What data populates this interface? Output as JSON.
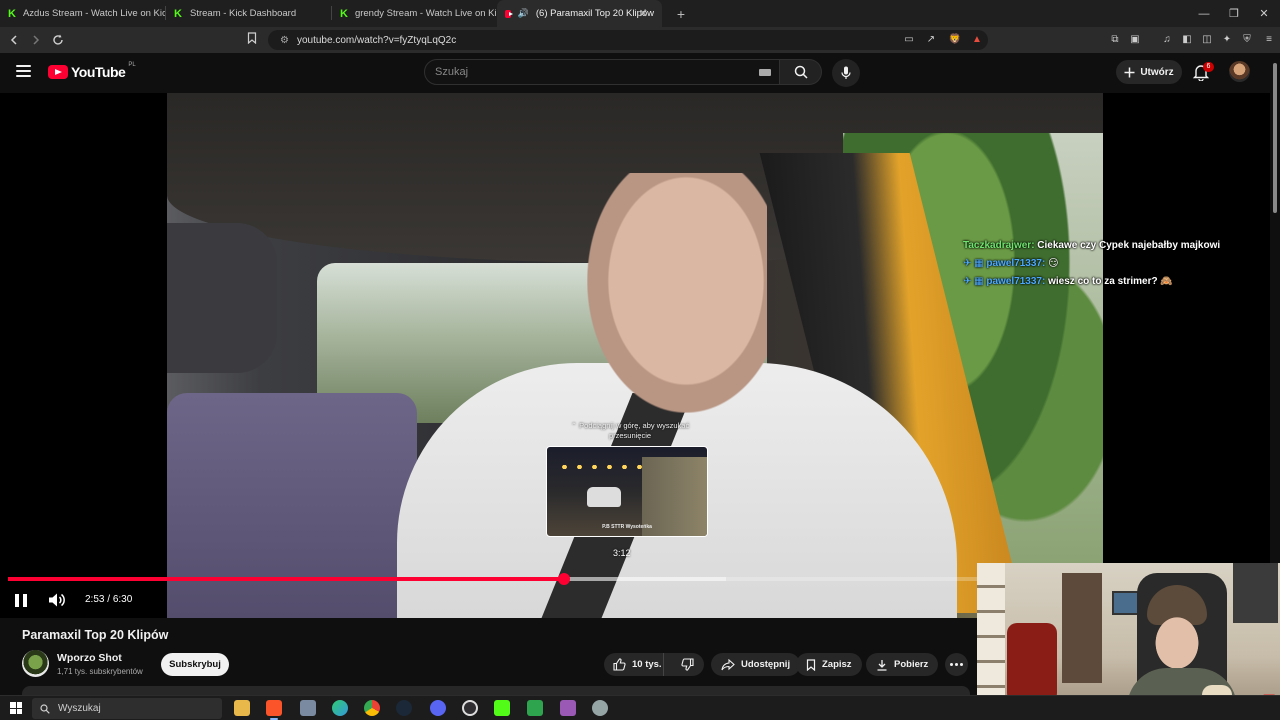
{
  "browser": {
    "tabs": [
      {
        "title": "Azdus Stream - Watch Live on Kick",
        "favicon": "kick-icon",
        "active": false
      },
      {
        "title": "Stream - Kick Dashboard",
        "favicon": "kick-icon",
        "active": false
      },
      {
        "title": "grendy Stream - Watch Live on Kick",
        "favicon": "kick-icon",
        "active": false
      },
      {
        "title": "(6) Paramaxil Top 20 Klipów",
        "favicon": "youtube-icon",
        "active": true
      }
    ],
    "url": "youtube.com/watch?v=fyZtyqLqQ2c"
  },
  "masthead": {
    "logo_text": "YouTube",
    "country_code": "PL",
    "search_placeholder": "Szukaj",
    "create_label": "Utwórz",
    "notification_count": "6"
  },
  "player": {
    "chat": [
      {
        "user": "Taczkadrajwer",
        "message": "Ciekawe czy Cypek najebałby majkowi"
      },
      {
        "user": "pawel71337",
        "message": "😏"
      },
      {
        "user": "pawel71337",
        "message": "wiesz co to za strimer? 🙈"
      }
    ],
    "preview_hint": "⌃ Podciągnij w górę, aby wyszukać przesunięcie",
    "preview_caption": "P.B  STTR Wysoteńka",
    "hover_time": "3:12",
    "current_time": "2:53",
    "duration": "6:30",
    "progress_fraction": 0.573,
    "buffered_fraction": 0.74
  },
  "video": {
    "title": "Paramaxil Top 20 Klipów",
    "channel": "Wporzo Shot",
    "subscribers": "1,71 tys. subskrybentów",
    "subscribe_label": "Subskrybuj",
    "likes": "10 tys.",
    "share_label": "Udostępnij",
    "save_label": "Zapisz",
    "download_label": "Pobierz"
  },
  "taskbar": {
    "search_placeholder": "Wyszukaj"
  },
  "colors": {
    "accent": "#ff0033",
    "background": "#0f0f0f",
    "pill": "#272727"
  }
}
